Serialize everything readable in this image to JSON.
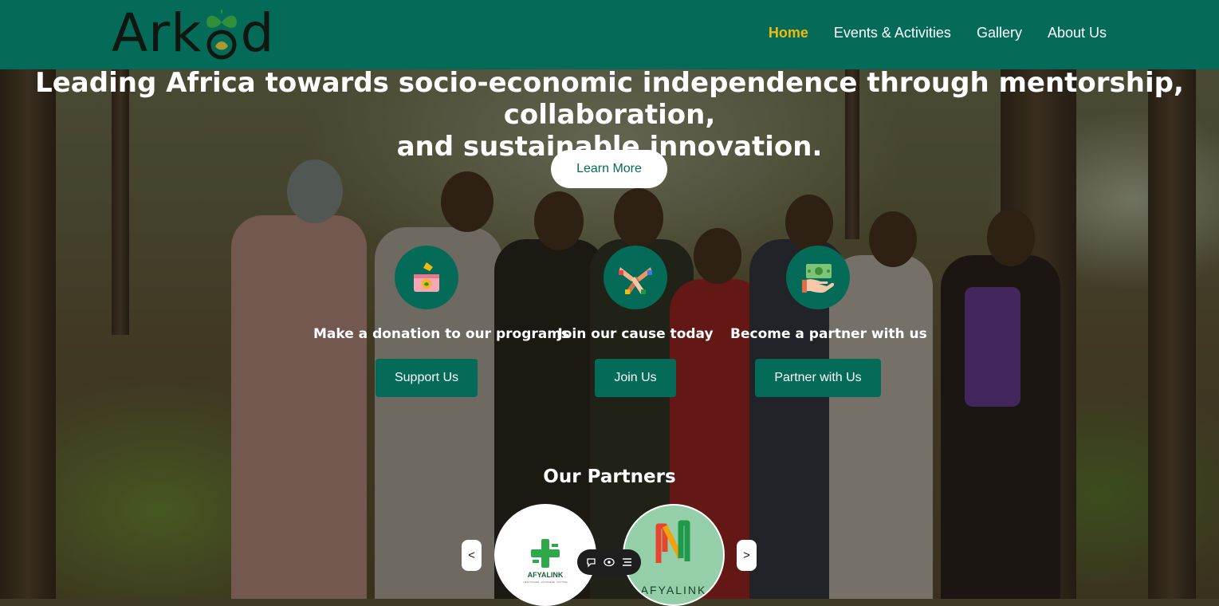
{
  "navbar": {
    "logo_text_left": "Ark",
    "logo_text_right": "d",
    "links": [
      {
        "label": "Home",
        "active": true
      },
      {
        "label": "Events & Activities",
        "active": false
      },
      {
        "label": "Gallery",
        "active": false
      },
      {
        "label": "About Us",
        "active": false
      }
    ]
  },
  "hero": {
    "headline_line1": "Leading Africa towards socio-economic independence through mentorship, collaboration,",
    "headline_line2": "and sustainable innovation.",
    "learn_more_label": "Learn More"
  },
  "cta": [
    {
      "icon": "donation-box-icon",
      "title": "Make a donation to our programs",
      "button": "Support Us"
    },
    {
      "icon": "joined-hands-icon",
      "title": "Join our cause today",
      "button": "Join Us"
    },
    {
      "icon": "money-hand-icon",
      "title": "Become a partner with us",
      "button": "Partner with Us"
    }
  ],
  "partners": {
    "title": "Our Partners",
    "prev_label": "<",
    "next_label": ">",
    "logos": [
      {
        "name": "AFYALINK",
        "tagline": "HEALTHCARE . ANYWHERE . ANYTIME"
      },
      {
        "name": "AFYALINK"
      }
    ]
  },
  "colors": {
    "brand_green": "#036b58",
    "active_nav": "#f2b90f"
  }
}
